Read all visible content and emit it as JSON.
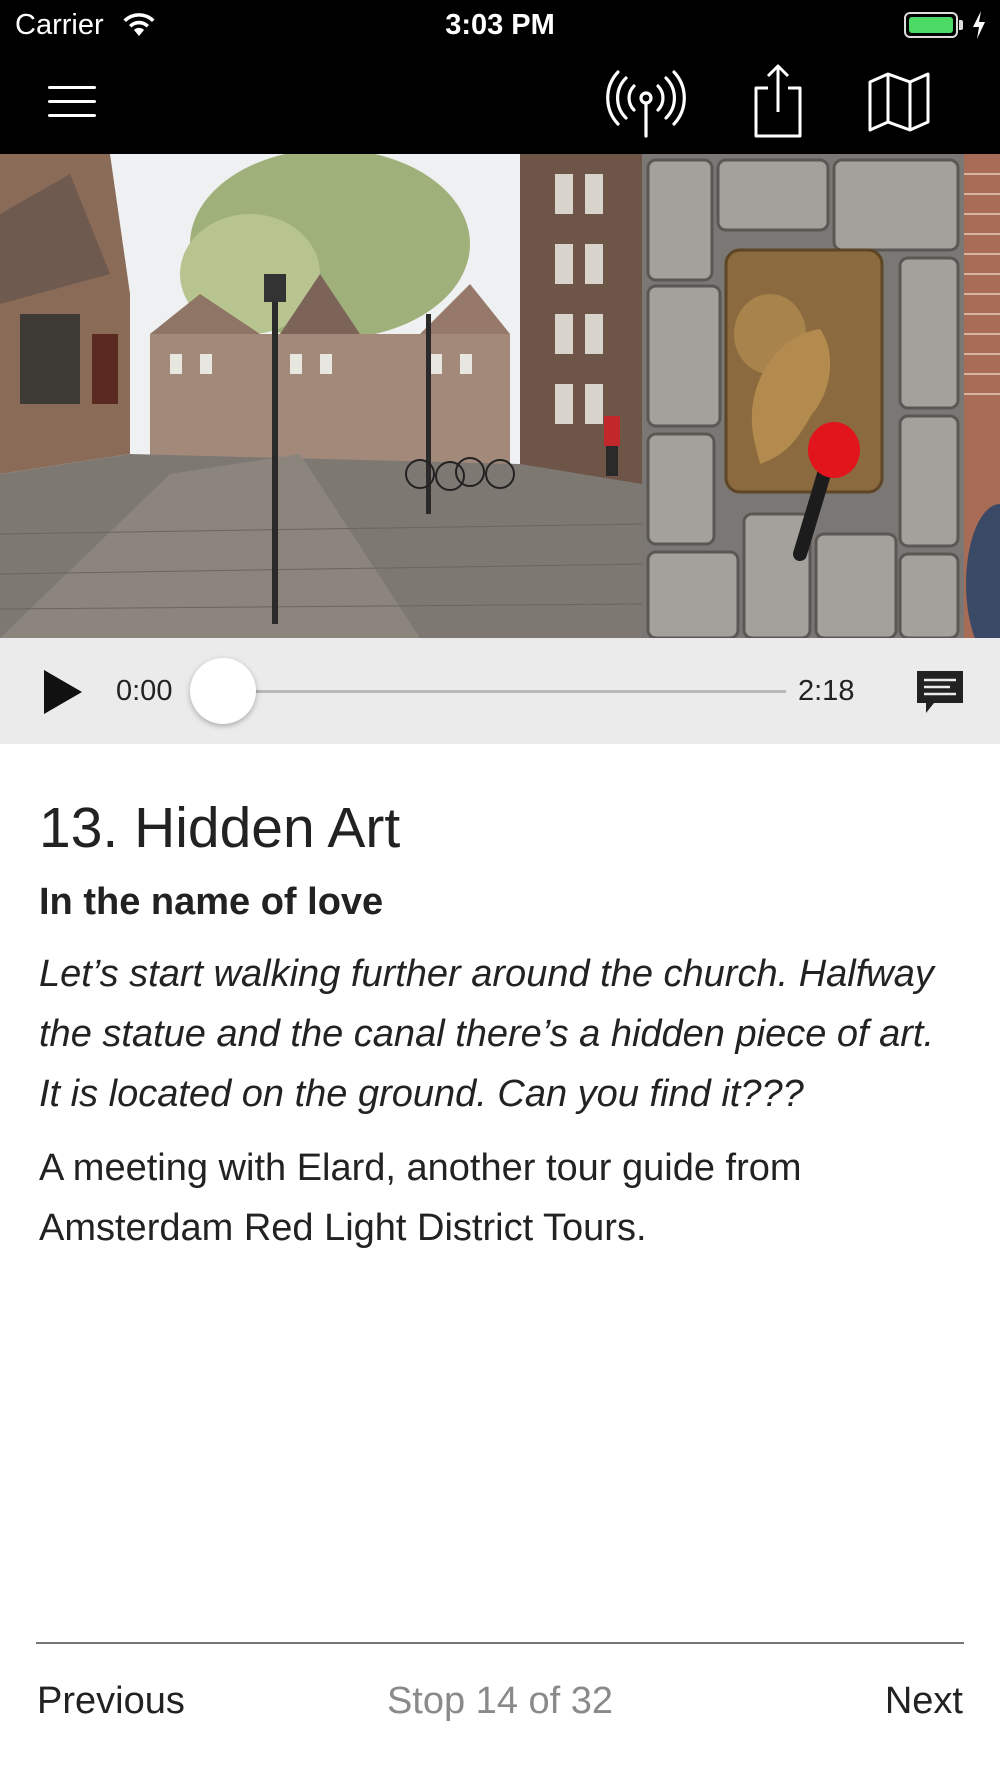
{
  "status_bar": {
    "carrier": "Carrier",
    "time": "3:03 PM",
    "battery_color": "#4cd964"
  },
  "nav_bar": {
    "menu_icon": "hamburger-menu-icon",
    "broadcast_icon": "broadcast-icon",
    "share_icon": "share-icon",
    "map_icon": "map-icon"
  },
  "player": {
    "current_time": "0:00",
    "total_time": "2:18",
    "progress": 0
  },
  "stop": {
    "title": "13. Hidden Art",
    "subtitle": "In the name of love",
    "intro": "Let’s start walking further around the church. Halfway the statue and the canal there’s a hidden piece of art. It is located on the ground. Can you find it???",
    "description": "A meeting with Elard, another tour guide from Amsterdam Red Light District Tours."
  },
  "footer": {
    "previous_label": "Previous",
    "counter_label": "Stop 14 of 32",
    "next_label": "Next"
  }
}
